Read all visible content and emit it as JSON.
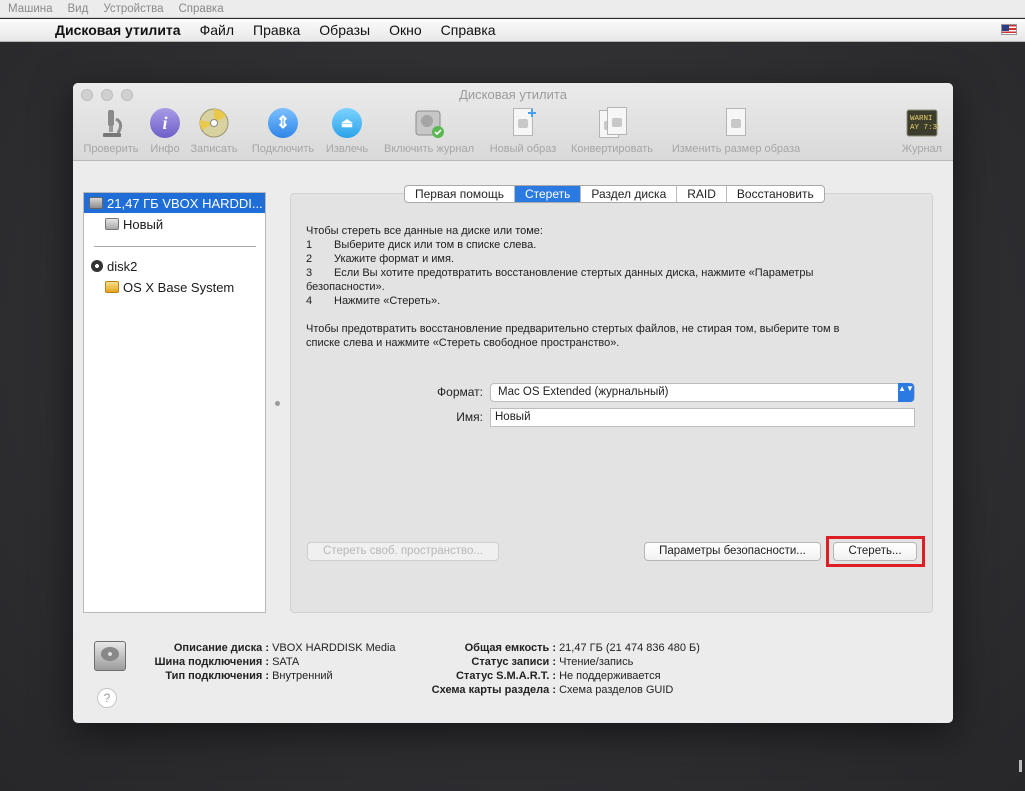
{
  "vbox_menu": [
    "Машина",
    "Вид",
    "Устройства",
    "Справка"
  ],
  "menubar": {
    "apple": "",
    "app_name": "Дисковая утилита",
    "items": [
      "Файл",
      "Правка",
      "Образы",
      "Окно",
      "Справка"
    ]
  },
  "window": {
    "title": "Дисковая утилита"
  },
  "toolbar": {
    "buttons": [
      {
        "label": "Проверить",
        "icon": "microscope-icon"
      },
      {
        "label": "Инфо",
        "icon": "info-icon"
      },
      {
        "label": "Записать",
        "icon": "burn-disc-icon"
      },
      {
        "label": "Подключить",
        "icon": "mount-icon"
      },
      {
        "label": "Извлечь",
        "icon": "eject-icon"
      },
      {
        "label": "Включить журнал",
        "icon": "journal-disk-icon"
      },
      {
        "label": "Новый образ",
        "icon": "new-image-icon"
      },
      {
        "label": "Конвертировать",
        "icon": "convert-icon"
      },
      {
        "label": "Изменить размер образа",
        "icon": "resize-image-icon"
      },
      {
        "label": "Журнал",
        "icon": "log-icon"
      }
    ],
    "log_icon_text": [
      "WARNI",
      "AY 7:36"
    ],
    "info_glyph": "i",
    "mount_glyph": "⇕",
    "eject_glyph": "⏏"
  },
  "sidebar": {
    "items": [
      {
        "label": "21,47 ГБ VBOX HARDDI...",
        "selected": true
      },
      {
        "label": "Новый"
      },
      {
        "label": "disk2"
      },
      {
        "label": "OS X Base System"
      }
    ]
  },
  "tabs": [
    {
      "label": "Первая помощь"
    },
    {
      "label": "Стереть",
      "active": true
    },
    {
      "label": "Раздел диска"
    },
    {
      "label": "RAID"
    },
    {
      "label": "Восстановить"
    }
  ],
  "instructions": {
    "intro": "Чтобы стереть все данные на диске или томе:",
    "steps": [
      {
        "num": "1",
        "text": "Выберите диск или том в списке слева."
      },
      {
        "num": "2",
        "text": "Укажите формат и имя."
      },
      {
        "num": "3",
        "text": "Если Вы хотите предотвратить восстановление стертых данных диска, нажмите «Параметры"
      },
      {
        "num": "",
        "text": "безопасности»."
      },
      {
        "num": "4",
        "text": "Нажмите «Стереть»."
      }
    ],
    "free_space_line1": "Чтобы предотвратить восстановление предварительно стертых файлов, не стирая том, выберите том в",
    "free_space_line2": "списке слева и нажмите «Стереть свободное пространство»."
  },
  "form": {
    "format_label": "Формат:",
    "format_value": "Mac OS Extended (журнальный)",
    "format_arrow": "▲▼",
    "name_label": "Имя:",
    "name_value": "Новый"
  },
  "buttons": {
    "erase_free_space": "Стереть своб. пространство...",
    "security_options": "Параметры безопасности...",
    "erase": "Стереть..."
  },
  "disk_info": {
    "left": [
      {
        "key": "Описание диска :",
        "value": "VBOX HARDDISK Media"
      },
      {
        "key": "Шина подключения :",
        "value": "SATA"
      },
      {
        "key": "Тип подключения :",
        "value": "Внутренний"
      }
    ],
    "right": [
      {
        "key": "Общая емкость :",
        "value": "21,47 ГБ (21 474 836 480 Б)"
      },
      {
        "key": "Статус записи :",
        "value": "Чтение/запись"
      },
      {
        "key": "Статус S.M.A.R.T. :",
        "value": "Не поддерживается"
      },
      {
        "key": "Схема карты раздела :",
        "value": "Схема разделов GUID"
      }
    ]
  },
  "help_label": "?",
  "colors": {
    "selection": "#1f6dd6",
    "active_tab": "#2a7ae2",
    "highlight_border": "#dd1e25"
  }
}
